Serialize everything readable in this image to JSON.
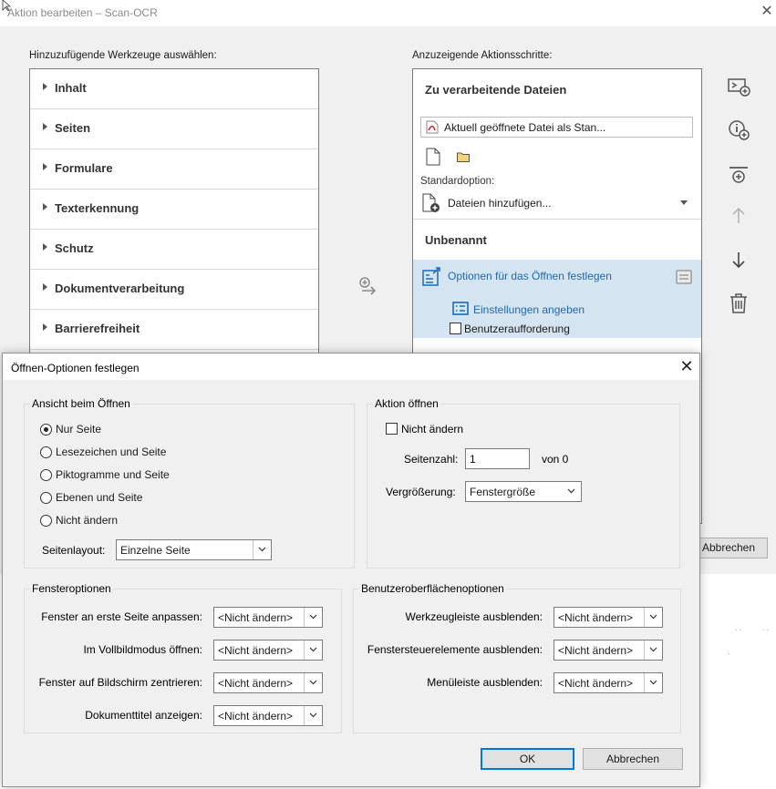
{
  "background_window": {
    "title": "Aktion bearbeiten – Scan-OCR",
    "left_label": "Hinzuzufügende Werkzeuge auswählen:",
    "right_label": "Anzuzeigende Aktionsschritte:",
    "tools": [
      "Inhalt",
      "Seiten",
      "Formulare",
      "Texterkennung",
      "Schutz",
      "Dokumentverarbeitung",
      "Barrierefreiheit"
    ],
    "steps": {
      "files_title": "Zu verarbeitende Dateien",
      "current_file": "Aktuell geöffnete Datei als Stan...",
      "standard_option_label": "Standardoption:",
      "add_files": "Dateien hinzufügen...",
      "unnamed_title": "Unbenannt",
      "step1": "Optionen für das Öffnen festlegen",
      "step1_settings": "Einstellungen angeben",
      "step1_prompt": "Benutzeraufforderung"
    },
    "cancel_button": "Abbrechen"
  },
  "dialog": {
    "title": "Öffnen-Optionen festlegen",
    "view_group": {
      "title": "Ansicht beim Öffnen",
      "options": [
        "Nur Seite",
        "Lesezeichen und Seite",
        "Piktogramme und Seite",
        "Ebenen und Seite",
        "Nicht ändern"
      ],
      "selected_index": 0,
      "page_layout_label": "Seitenlayout:",
      "page_layout_value": "Einzelne Seite"
    },
    "action_group": {
      "title": "Aktion öffnen",
      "no_change_label": "Nicht ändern",
      "no_change_checked": false,
      "page_number_label": "Seitenzahl:",
      "page_number_value": "1",
      "page_of": "von 0",
      "zoom_label": "Vergrößerung:",
      "zoom_value": "Fenstergröße"
    },
    "window_group": {
      "title": "Fensteroptionen",
      "rows": [
        {
          "label": "Fenster an erste Seite anpassen:",
          "value": "<Nicht ändern>"
        },
        {
          "label": "Im Vollbildmodus öffnen:",
          "value": "<Nicht ändern>"
        },
        {
          "label": "Fenster auf Bildschirm zentrieren:",
          "value": "<Nicht ändern>"
        },
        {
          "label": "Dokumenttitel anzeigen:",
          "value": "<Nicht ändern>"
        }
      ]
    },
    "ui_group": {
      "title": "Benutzeroberflächenoptionen",
      "rows": [
        {
          "label": "Werkzeugleiste ausblenden:",
          "value": "<Nicht ändern>"
        },
        {
          "label": "Fenstersteuerelemente ausblenden:",
          "value": "<Nicht ändern>"
        },
        {
          "label": "Menüleiste ausblenden:",
          "value": "<Nicht ändern>"
        }
      ]
    },
    "ok_button": "OK",
    "cancel_button": "Abbrechen"
  }
}
